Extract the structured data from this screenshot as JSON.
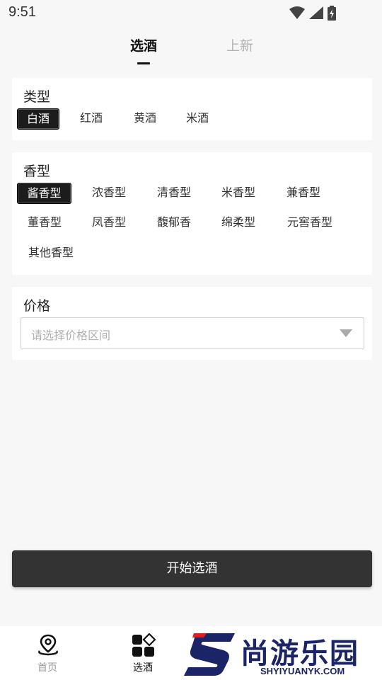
{
  "status_bar": {
    "time": "9:51"
  },
  "top_tabs": [
    {
      "label": "选酒",
      "active": true
    },
    {
      "label": "上新",
      "active": false
    }
  ],
  "type_section": {
    "title": "类型",
    "options": [
      "白酒",
      "红酒",
      "黄酒",
      "米酒"
    ],
    "selected": "白酒"
  },
  "aroma_section": {
    "title": "香型",
    "options": [
      "酱香型",
      "浓香型",
      "清香型",
      "米香型",
      "兼香型",
      "董香型",
      "凤香型",
      "馥郁香",
      "绵柔型",
      "元窖香型",
      "其他香型"
    ],
    "selected": "酱香型"
  },
  "price_section": {
    "title": "价格",
    "placeholder": "请选择价格区间"
  },
  "start_button": {
    "label": "开始选酒"
  },
  "bottom_nav": [
    {
      "label": "首页",
      "icon": "map-pin-icon",
      "active": false
    },
    {
      "label": "选酒",
      "icon": "grid-diamond-icon",
      "active": true
    }
  ],
  "watermark": {
    "brand": "尚游乐园",
    "url": "SHYIYUANYK.COM",
    "color": "#1a2466"
  },
  "colors": {
    "accent_dark": "#1c1c1c",
    "button_bg": "#333333",
    "inactive_text": "#b3b3b3"
  }
}
